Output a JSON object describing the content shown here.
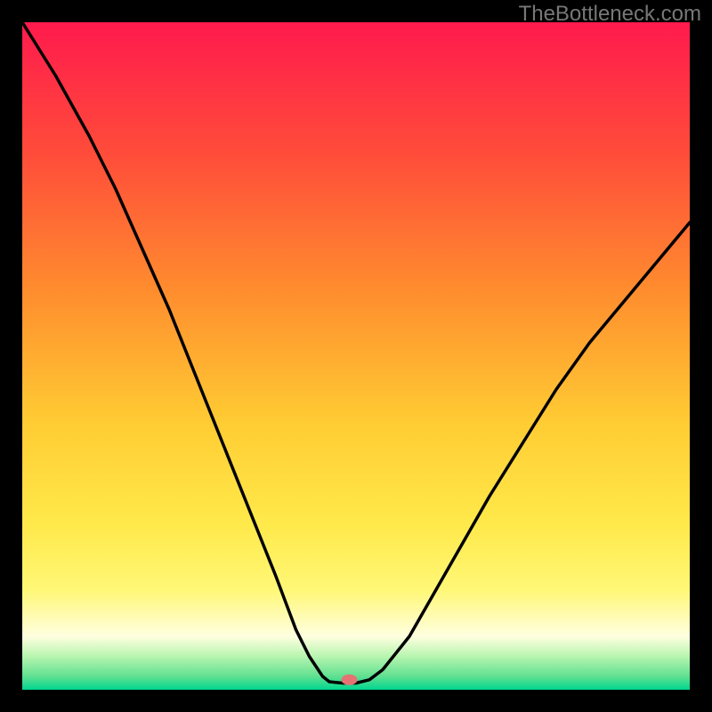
{
  "watermark": "TheBottleneck.com",
  "chart_data": {
    "type": "line",
    "title": "",
    "xlabel": "",
    "ylabel": "",
    "xlim": [
      0,
      100
    ],
    "ylim": [
      0,
      100
    ],
    "x": [
      0,
      5,
      10,
      14,
      18,
      22,
      26,
      30,
      34,
      38,
      41,
      43,
      45,
      46,
      48,
      50,
      52,
      54,
      58,
      62,
      66,
      70,
      75,
      80,
      85,
      90,
      95,
      100
    ],
    "values": [
      100,
      92,
      83,
      75,
      66,
      57,
      47,
      37,
      27,
      17,
      9,
      5,
      2,
      1.2,
      1,
      1,
      1.5,
      3,
      8,
      15,
      22,
      29,
      37,
      45,
      52,
      58,
      64,
      70
    ],
    "marker": {
      "x": 49,
      "y": 1.5,
      "color": "#e57373"
    },
    "gradient_stops": [
      {
        "offset": 0.0,
        "color": "#ff1a4d"
      },
      {
        "offset": 0.2,
        "color": "#ff4d3a"
      },
      {
        "offset": 0.4,
        "color": "#ff8c2e"
      },
      {
        "offset": 0.6,
        "color": "#ffcc33"
      },
      {
        "offset": 0.75,
        "color": "#ffe94a"
      },
      {
        "offset": 0.85,
        "color": "#fff776"
      },
      {
        "offset": 0.92,
        "color": "#ffffe0"
      },
      {
        "offset": 0.95,
        "color": "#b8f5b0"
      },
      {
        "offset": 0.98,
        "color": "#5fe090"
      },
      {
        "offset": 1.0,
        "color": "#00d68f"
      }
    ]
  }
}
